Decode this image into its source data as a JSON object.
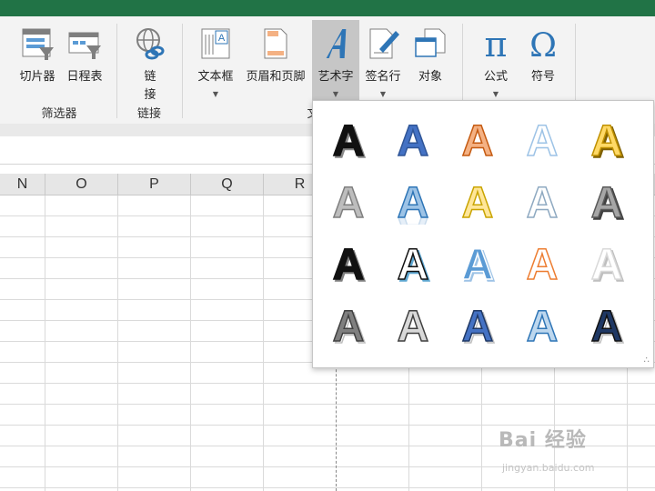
{
  "ribbon": {
    "buttons": [
      {
        "label": "切片器"
      },
      {
        "label": "日程表"
      },
      {
        "label": "链",
        "label2": "接"
      },
      {
        "label": "文本框"
      },
      {
        "label": "页眉和页脚"
      },
      {
        "label": "艺术字"
      },
      {
        "label": "签名行"
      },
      {
        "label": "对象"
      },
      {
        "label": "公式"
      },
      {
        "label": "符号"
      }
    ],
    "groups": {
      "filters": "筛选器",
      "links": "链接",
      "text_partial": "文"
    }
  },
  "sheet": {
    "columns": [
      "N",
      "O",
      "P",
      "Q",
      "R"
    ]
  },
  "gallery": {
    "glyph": "A",
    "styles": [
      {
        "fill": "#111111",
        "stroke": "#111111",
        "shadow": "#888888"
      },
      {
        "fill": "#4472c4",
        "stroke": "#2f5597",
        "shadow": "none"
      },
      {
        "fill": "#f4b183",
        "stroke": "#c55a11",
        "shadow": "none"
      },
      {
        "fill": "#ffffff",
        "stroke": "#9dc3e6",
        "shadow": "none"
      },
      {
        "fill": "#ffd966",
        "stroke": "#bf9000",
        "shadow": "#7f6000"
      },
      {
        "fill": "#bdbdbd",
        "stroke": "#7f7f7f",
        "shadow": "none"
      },
      {
        "fill": "#9dc3e6",
        "stroke": "#2e75b6",
        "shadow": "reflect"
      },
      {
        "fill": "#ffe699",
        "stroke": "#c9a400",
        "shadow": "none"
      },
      {
        "fill": "#ffffff",
        "stroke": "#8ea9c1",
        "shadow": "none"
      },
      {
        "fill": "#a6a6a6",
        "stroke": "#595959",
        "shadow": "#404040"
      },
      {
        "fill": "#111111",
        "stroke": "#111111",
        "shadow": "#7f7f7f"
      },
      {
        "fill": "#ffffff",
        "stroke": "#111111",
        "shadow": "#5fa8d3"
      },
      {
        "fill": "#5b9bd5",
        "stroke": "#ffffff",
        "shadow": "#9dc3e6"
      },
      {
        "fill": "#ffffff",
        "stroke": "#ed7d31",
        "shadow": "none"
      },
      {
        "fill": "#ffffff",
        "stroke": "#d9d9d9",
        "shadow": "#bfbfbf"
      },
      {
        "fill": "#7f7f7f",
        "stroke": "#404040",
        "shadow": "stripes"
      },
      {
        "fill": "#d9d9d9",
        "stroke": "#404040",
        "shadow": "none"
      },
      {
        "fill": "#4472c4",
        "stroke": "#1f3864",
        "shadow": "stripes"
      },
      {
        "fill": "#bdd7ee",
        "stroke": "#2e75b6",
        "shadow": "none"
      },
      {
        "fill": "#1f3864",
        "stroke": "#111111",
        "shadow": "stripes"
      }
    ]
  },
  "watermark": {
    "brand": "Bai 经验",
    "url": "jingyan.baidu.com"
  }
}
